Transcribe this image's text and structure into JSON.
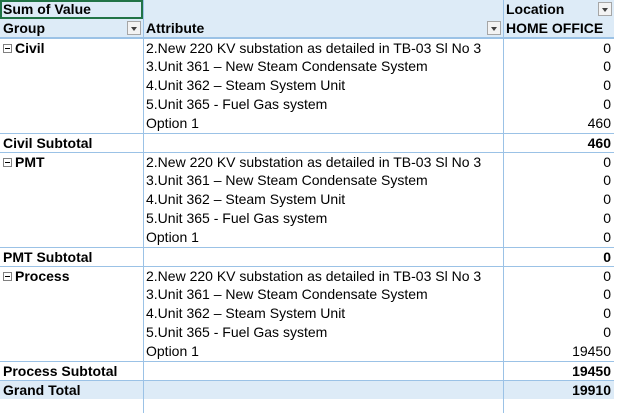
{
  "header": {
    "sum_of_value": "Sum of Value",
    "location": "Location",
    "group": "Group",
    "attribute": "Attribute",
    "home_office": "HOME OFFICE"
  },
  "groups": [
    {
      "name": "Civil",
      "rows": [
        {
          "attribute": "2.New 220 KV substation as detailed in TB-03 Sl No 3",
          "value": "0"
        },
        {
          "attribute": "3.Unit 361 – New Steam Condensate System",
          "value": "0"
        },
        {
          "attribute": "4.Unit 362 – Steam System Unit",
          "value": "0"
        },
        {
          "attribute": "5.Unit 365 - Fuel Gas system",
          "value": "0"
        },
        {
          "attribute": "Option 1",
          "value": "460"
        }
      ],
      "subtotal_label": "Civil Subtotal",
      "subtotal": "460"
    },
    {
      "name": "PMT",
      "rows": [
        {
          "attribute": "2.New 220 KV substation as detailed in TB-03 Sl No 3",
          "value": "0"
        },
        {
          "attribute": "3.Unit 361 – New Steam Condensate System",
          "value": "0"
        },
        {
          "attribute": "4.Unit 362 – Steam System Unit",
          "value": "0"
        },
        {
          "attribute": "5.Unit 365 - Fuel Gas system",
          "value": "0"
        },
        {
          "attribute": "Option 1",
          "value": "0"
        }
      ],
      "subtotal_label": "PMT Subtotal",
      "subtotal": "0"
    },
    {
      "name": "Process",
      "rows": [
        {
          "attribute": "2.New 220 KV substation as detailed in TB-03 Sl No 3",
          "value": "0"
        },
        {
          "attribute": "3.Unit 361 – New Steam Condensate System",
          "value": "0"
        },
        {
          "attribute": "4.Unit 362 – Steam System Unit",
          "value": "0"
        },
        {
          "attribute": "5.Unit 365 - Fuel Gas system",
          "value": "0"
        },
        {
          "attribute": "Option 1",
          "value": "19450"
        }
      ],
      "subtotal_label": "Process Subtotal",
      "subtotal": "19450"
    }
  ],
  "grand_total": {
    "label": "Grand Total",
    "value": "19910"
  }
}
